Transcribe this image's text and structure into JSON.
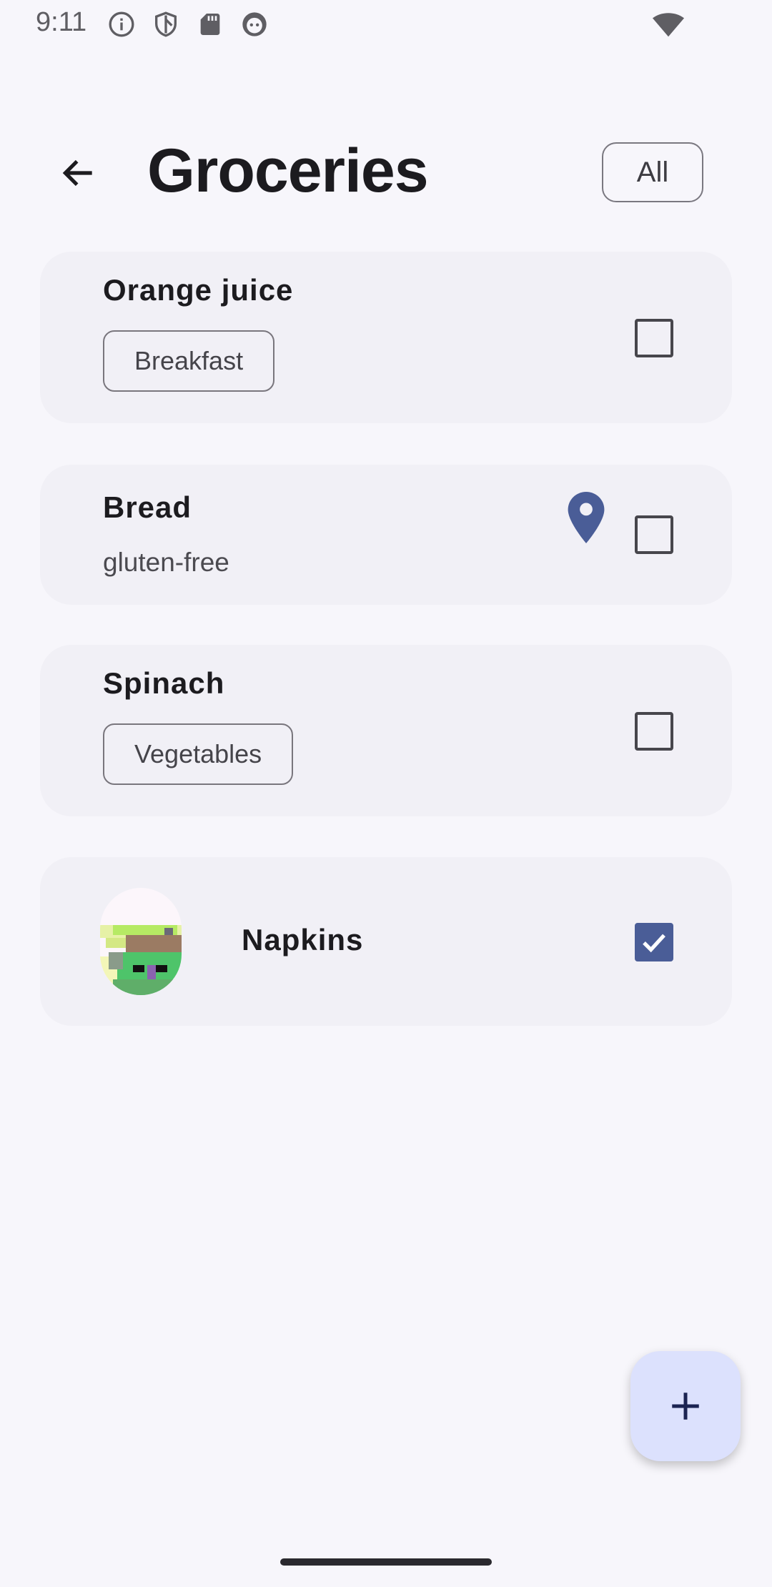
{
  "status_bar": {
    "time": "9:11",
    "icons": [
      "info-icon",
      "shield-icon",
      "sd-card-icon",
      "face-icon"
    ],
    "right_icons": [
      "wifi-icon"
    ]
  },
  "header": {
    "back_icon": "arrow-back-icon",
    "title": "Groceries",
    "filter_label": "All"
  },
  "items": [
    {
      "title": "Orange juice",
      "tag": "Breakfast",
      "checked": false
    },
    {
      "title": "Bread",
      "subtitle": "gluten-free",
      "location_icon": "location-pin-icon",
      "checked": false
    },
    {
      "title": "Spinach",
      "tag": "Vegetables",
      "checked": false
    },
    {
      "title": "Napkins",
      "image": "pixel-avatar",
      "checked": true
    }
  ],
  "fab": {
    "icon": "plus-icon"
  },
  "colors": {
    "background": "#f7f6fb",
    "card": "#f1f0f6",
    "accent": "#4a5d97",
    "fab": "#dce1fd"
  }
}
